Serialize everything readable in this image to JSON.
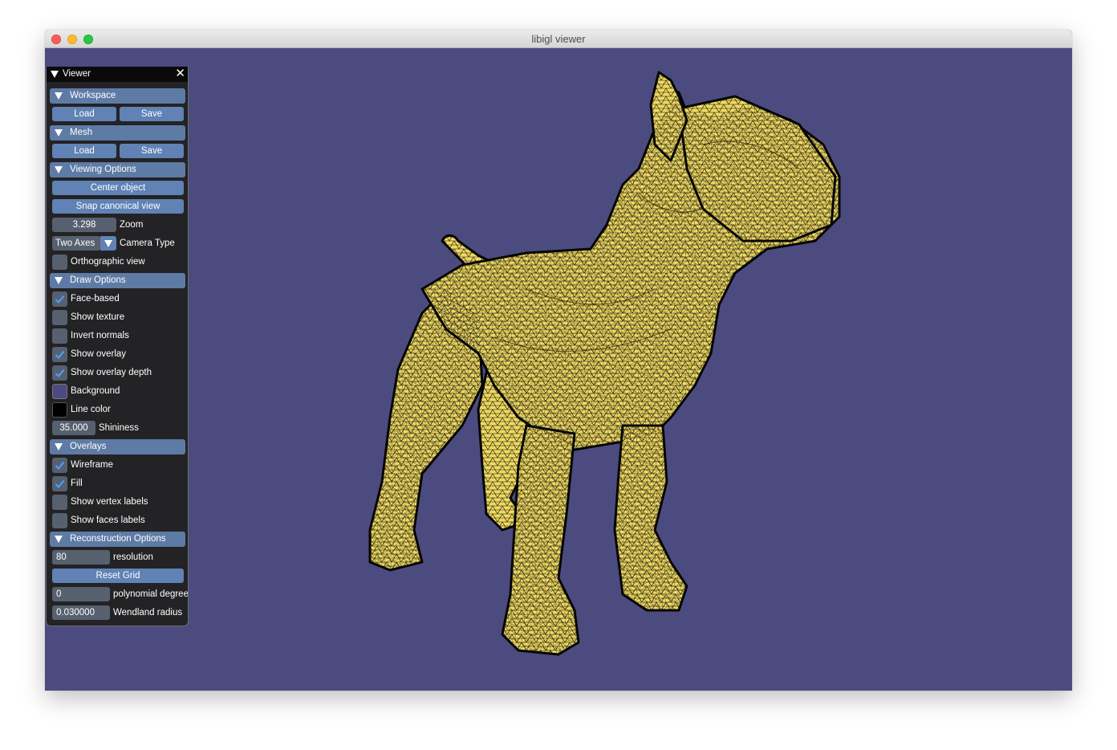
{
  "window": {
    "title": "libigl viewer"
  },
  "viewer": {
    "title": "Viewer"
  },
  "colors": {
    "background": "#4c4b7f",
    "mesh_fill": "#f0dc63",
    "wire": "#000000",
    "header": "#5e7ba5",
    "button": "#6082b4"
  },
  "workspace": {
    "header": "Workspace",
    "load": "Load",
    "save": "Save"
  },
  "mesh": {
    "header": "Mesh",
    "load": "Load",
    "save": "Save"
  },
  "viewing": {
    "header": "Viewing Options",
    "center": "Center object",
    "snap": "Snap canonical view",
    "zoom_value": "3.298",
    "zoom_label": "Zoom",
    "camera_value": "Two Axes",
    "camera_label": "Camera Type",
    "ortho_label": "Orthographic view",
    "ortho_checked": false
  },
  "draw": {
    "header": "Draw Options",
    "items": [
      {
        "label": "Face-based",
        "checked": true
      },
      {
        "label": "Show texture",
        "checked": false
      },
      {
        "label": "Invert normals",
        "checked": false
      },
      {
        "label": "Show overlay",
        "checked": true
      },
      {
        "label": "Show overlay depth",
        "checked": true
      }
    ],
    "background_label": "Background",
    "background_color": "#4c4b7f",
    "line_color_label": "Line color",
    "line_color": "#000000",
    "shininess_value": "35.000",
    "shininess_label": "Shininess"
  },
  "overlays": {
    "header": "Overlays",
    "items": [
      {
        "label": "Wireframe",
        "checked": true
      },
      {
        "label": "Fill",
        "checked": true
      },
      {
        "label": "Show vertex labels",
        "checked": false
      },
      {
        "label": "Show faces labels",
        "checked": false
      }
    ]
  },
  "recon": {
    "header": "Reconstruction Options",
    "resolution_value": "80",
    "resolution_label": "resolution",
    "reset": "Reset Grid",
    "degree_value": "0",
    "degree_label": "polynomial degree",
    "radius_value": "0.030000",
    "radius_label": "Wendland radius"
  }
}
